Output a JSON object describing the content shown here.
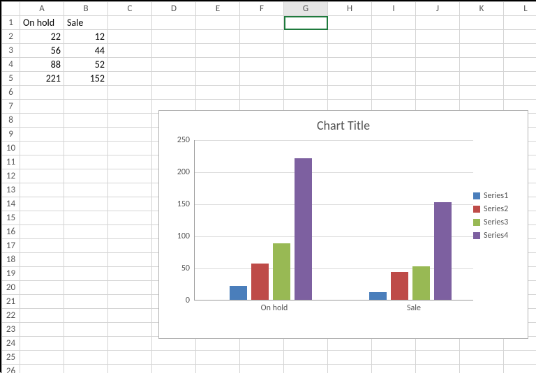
{
  "columns": [
    "A",
    "B",
    "C",
    "D",
    "E",
    "F",
    "G",
    "H",
    "I",
    "J",
    "K",
    "L"
  ],
  "active_column": "G",
  "rows": 26,
  "cells": {
    "A1": {
      "v": "On hold",
      "t": "txt"
    },
    "B1": {
      "v": "Sale",
      "t": "txt"
    },
    "A2": {
      "v": "22",
      "t": "num"
    },
    "B2": {
      "v": "12",
      "t": "num"
    },
    "A3": {
      "v": "56",
      "t": "num"
    },
    "B3": {
      "v": "44",
      "t": "num"
    },
    "A4": {
      "v": "88",
      "t": "num"
    },
    "B4": {
      "v": "52",
      "t": "num"
    },
    "A5": {
      "v": "221",
      "t": "num"
    },
    "B5": {
      "v": "152",
      "t": "num"
    }
  },
  "selected_cell": "G1",
  "chart": {
    "title": "Chart Title",
    "ylim": [
      0,
      250
    ],
    "yticks": [
      0,
      50,
      100,
      150,
      200,
      250
    ],
    "categories": [
      "On hold",
      "Sale"
    ],
    "series": [
      {
        "name": "Series1",
        "color": "c1"
      },
      {
        "name": "Series2",
        "color": "c2"
      },
      {
        "name": "Series3",
        "color": "c3"
      },
      {
        "name": "Series4",
        "color": "c4"
      }
    ]
  },
  "chart_data": {
    "type": "bar",
    "title": "Chart Title",
    "xlabel": "",
    "ylabel": "",
    "ylim": [
      0,
      250
    ],
    "categories": [
      "On hold",
      "Sale"
    ],
    "series": [
      {
        "name": "Series1",
        "values": [
          22,
          12
        ]
      },
      {
        "name": "Series2",
        "values": [
          56,
          44
        ]
      },
      {
        "name": "Series3",
        "values": [
          88,
          52
        ]
      },
      {
        "name": "Series4",
        "values": [
          221,
          152
        ]
      }
    ]
  }
}
